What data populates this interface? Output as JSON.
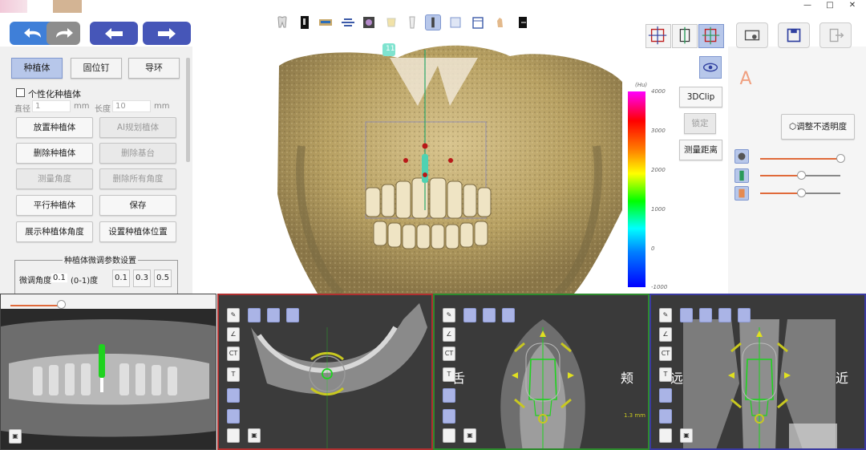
{
  "window": {
    "minimize": "—",
    "restore": "□",
    "close": "✕"
  },
  "colors": {
    "accent": "#3f7fd8",
    "nav_blue": "#4656b8",
    "pano_border": "#444444",
    "axial_border": "#b03030",
    "sagittal_border": "#2e8b2e",
    "coronal_border": "#3a3aa0"
  },
  "nav": {
    "undo_icon": "undo-arrow-icon",
    "redo_icon": "redo-arrow-icon",
    "back_icon": "left-arrow-icon",
    "forward_icon": "right-arrow-icon"
  },
  "tabs": [
    {
      "label": "种植体",
      "active": true
    },
    {
      "label": "固位钉",
      "active": false
    },
    {
      "label": "导环",
      "active": false
    }
  ],
  "custom_implant": {
    "label": "个性化种植体",
    "checked": false
  },
  "diameter": {
    "label": "直径",
    "value": "1",
    "unit": "mm"
  },
  "length": {
    "label": "长度",
    "value": "10",
    "unit": "mm"
  },
  "buttons": {
    "place_implant": "放置种植体",
    "ai_plan": "AI规划植体",
    "delete_implant": "删除种植体",
    "delete_abutment": "删除基台",
    "measure_angle": "测量角度",
    "delete_all_angles": "删除所有角度",
    "parallel_implant": "平行种植体",
    "save": "保存",
    "show_angle": "展示种植体角度",
    "set_position": "设置种植体位置"
  },
  "fine_tune": {
    "title": "种植体微调参数设置",
    "angle_label": "微调角度",
    "angle_value": "0.1",
    "range_label": "(0-1)度",
    "steps": [
      "0.1",
      "0.3",
      "0.5"
    ]
  },
  "implant_label": "11",
  "colorbar": {
    "unit": "(Hu)",
    "ticks": [
      "4000",
      "3000",
      "2000",
      "1000",
      "0",
      "-1000"
    ]
  },
  "side_buttons": {
    "clip": "3DClip",
    "lock": "锁定",
    "measure": "测量距离"
  },
  "opacity_button": "调整不透明度",
  "sliders": {
    "opacity_1": 1.0,
    "opacity_2": 0.48,
    "opacity_3": 0.48,
    "pano_slider": 0.55
  },
  "ct_tools": {
    "ct": "CT",
    "t": "T",
    "a_glyph": "A"
  },
  "sagittal_dirs": {
    "left": "舌",
    "right": "颊"
  },
  "coronal_dirs": {
    "left": "远",
    "right": "近"
  },
  "scale_label": "1.3 mm"
}
